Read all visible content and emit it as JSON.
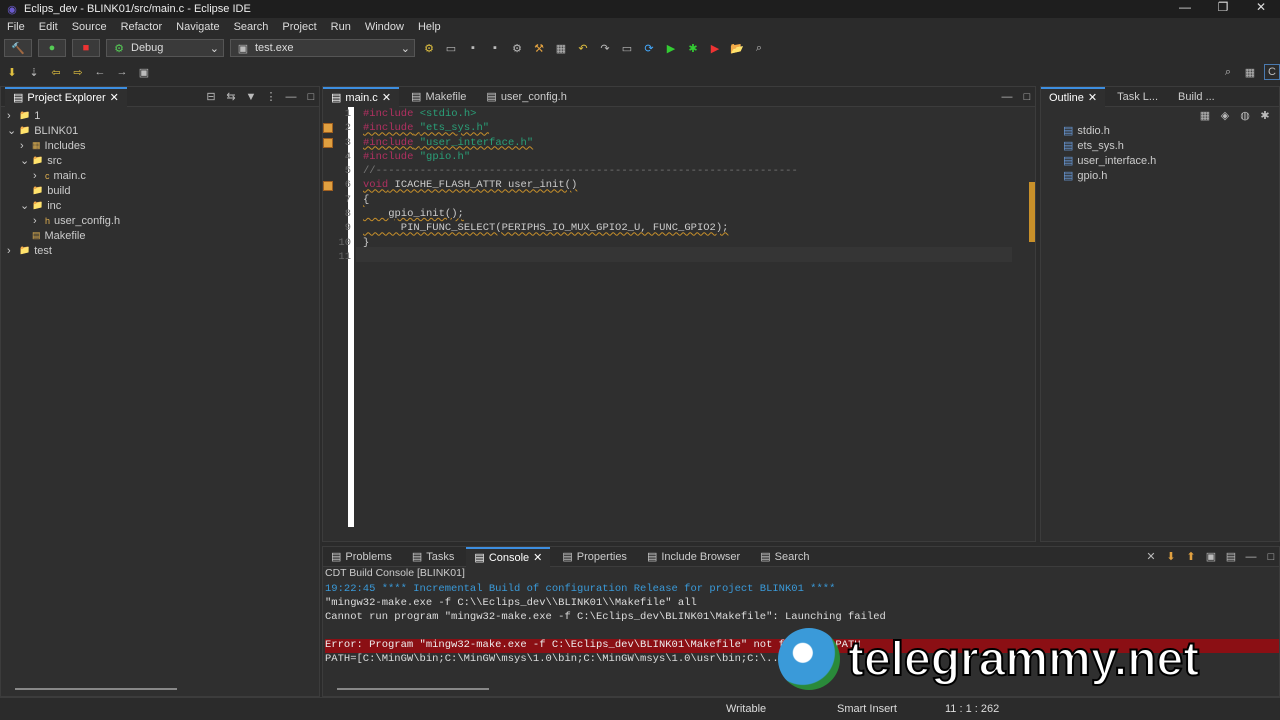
{
  "window": {
    "title": "Eclips_dev - BLINK01/src/main.c - Eclipse IDE",
    "min": "—",
    "max": "❐",
    "close": "✕"
  },
  "menu": [
    "File",
    "Edit",
    "Source",
    "Refactor",
    "Navigate",
    "Search",
    "Project",
    "Run",
    "Window",
    "Help"
  ],
  "toolbar": {
    "launch_mode": "Debug",
    "launch_config": "test.exe"
  },
  "project_explorer": {
    "title": "Project Explorer",
    "items": [
      {
        "label": "1",
        "depth": 0,
        "arrow": "›",
        "icon": "📁"
      },
      {
        "label": "BLINK01",
        "depth": 0,
        "arrow": "⌄",
        "icon": "📁"
      },
      {
        "label": "Includes",
        "depth": 1,
        "arrow": "›",
        "icon": "▦"
      },
      {
        "label": "src",
        "depth": 1,
        "arrow": "⌄",
        "icon": "📁"
      },
      {
        "label": "main.c",
        "depth": 2,
        "arrow": "›",
        "icon": "c"
      },
      {
        "label": "build",
        "depth": 1,
        "arrow": "",
        "icon": "📁"
      },
      {
        "label": "inc",
        "depth": 1,
        "arrow": "⌄",
        "icon": "📁"
      },
      {
        "label": "user_config.h",
        "depth": 2,
        "arrow": "›",
        "icon": "h"
      },
      {
        "label": "Makefile",
        "depth": 1,
        "arrow": "",
        "icon": "▤"
      },
      {
        "label": "test",
        "depth": 0,
        "arrow": "›",
        "icon": "📁"
      }
    ]
  },
  "editor": {
    "tabs": [
      "main.c",
      "Makefile",
      "user_config.h"
    ],
    "lines": [
      {
        "n": "1",
        "parts": [
          [
            "kw",
            "#include"
          ],
          [
            "tx",
            " "
          ],
          [
            "str",
            "<stdio.h>"
          ]
        ]
      },
      {
        "n": "2",
        "parts": [
          [
            "kw wv",
            "#include"
          ],
          [
            "tx wv",
            " "
          ],
          [
            "str wv",
            "\"ets_sys.h\""
          ]
        ]
      },
      {
        "n": "3",
        "parts": [
          [
            "kw wv",
            "#include"
          ],
          [
            "tx wv",
            " "
          ],
          [
            "str wv",
            "\"user_interface.h\""
          ]
        ]
      },
      {
        "n": "4",
        "parts": [
          [
            "kw",
            "#include"
          ],
          [
            "tx",
            " "
          ],
          [
            "str",
            "\"gpio.h\""
          ]
        ]
      },
      {
        "n": "5",
        "parts": [
          [
            "cm",
            "//-------------------------------------------------------------------"
          ]
        ]
      },
      {
        "n": "6",
        "parts": [
          [
            "kw wv",
            "void"
          ],
          [
            "tx wv",
            " ICACHE_FLASH_ATTR user_init()"
          ]
        ]
      },
      {
        "n": "7",
        "parts": [
          [
            "tx wv",
            "{"
          ]
        ]
      },
      {
        "n": "8",
        "parts": [
          [
            "tx wv",
            "    gpio_init();"
          ]
        ]
      },
      {
        "n": "9",
        "parts": [
          [
            "tx wv",
            "      PIN_FUNC_SELECT(PERIPHS_IO_MUX_GPIO2_U, FUNC_GPIO2);"
          ]
        ]
      },
      {
        "n": "10",
        "parts": [
          [
            "tx",
            "}"
          ]
        ]
      },
      {
        "n": "11",
        "parts": [
          [
            "tx",
            ""
          ]
        ]
      }
    ]
  },
  "outline": {
    "tabs": [
      "Outline",
      "Task L...",
      "Build ..."
    ],
    "items": [
      "stdio.h",
      "ets_sys.h",
      "user_interface.h",
      "gpio.h"
    ]
  },
  "bottom": {
    "tabs": [
      "Problems",
      "Tasks",
      "Console",
      "Properties",
      "Include Browser",
      "Search"
    ],
    "console_title": "CDT Build Console [BLINK01]",
    "lines": [
      {
        "cls": "info",
        "text": "19:22:45 **** Incremental Build of configuration Release for project BLINK01 ****"
      },
      {
        "cls": "",
        "text": "\"mingw32-make.exe -f C:\\\\Eclips_dev\\\\BLINK01\\\\Makefile\" all"
      },
      {
        "cls": "",
        "text": "Cannot run program \"mingw32-make.exe -f C:\\Eclips_dev\\BLINK01\\Makefile\": Launching failed"
      },
      {
        "cls": "",
        "text": ""
      },
      {
        "cls": "err",
        "text": "Error: Program \"mingw32-make.exe -f C:\\Eclips_dev\\BLINK01\\Makefile\" not found in PATH"
      },
      {
        "cls": "",
        "text": "PATH=[C:\\MinGW\\bin;C:\\MinGW\\msys\\1.0\\bin;C:\\MinGW\\msys\\1.0\\usr\\bin;C:\\..."
      }
    ]
  },
  "watermark": "telegrammy.net",
  "status": {
    "writable": "Writable",
    "insert": "Smart Insert",
    "position": "11 : 1 : 262"
  }
}
